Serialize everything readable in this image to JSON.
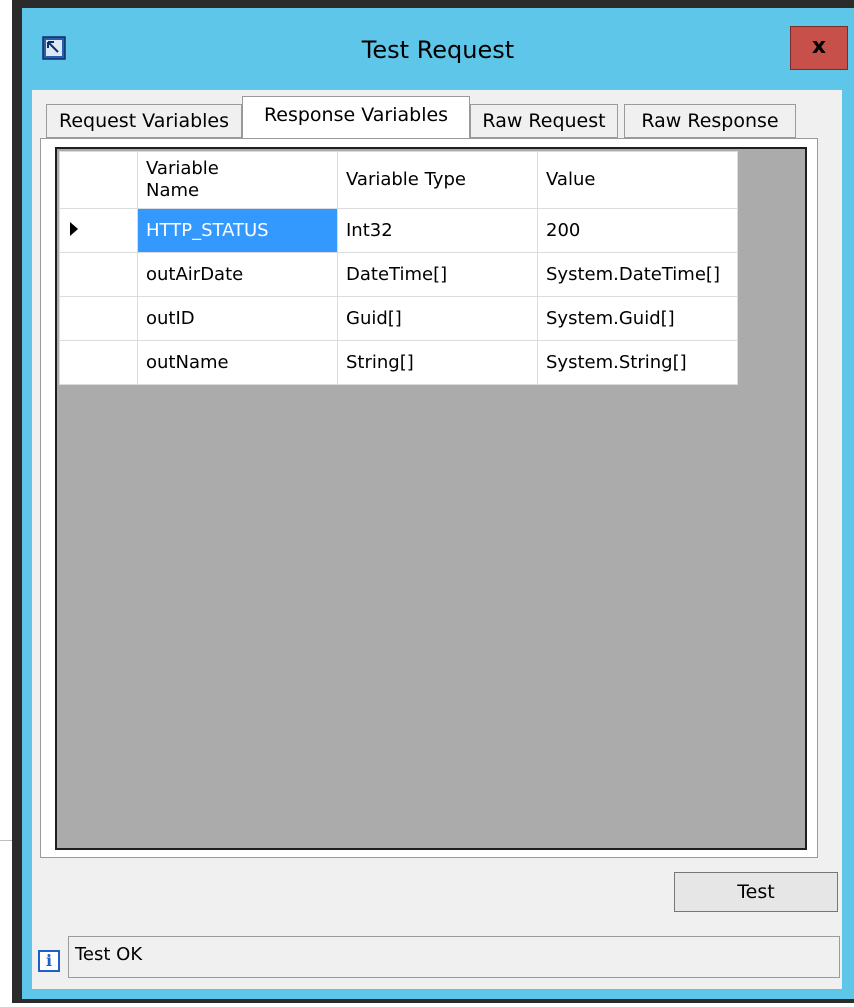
{
  "window": {
    "title": "Test Request",
    "close_label": "x"
  },
  "tabs": [
    {
      "label": "Request Variables",
      "active": false
    },
    {
      "label": "Response Variables",
      "active": true
    },
    {
      "label": "Raw Request",
      "active": false
    },
    {
      "label": "Raw Response",
      "active": false
    }
  ],
  "grid": {
    "columns": [
      "Variable Name",
      "Variable Type",
      "Value"
    ],
    "rows": [
      {
        "name": "HTTP_STATUS",
        "type": "Int32",
        "value": "200",
        "selected": true
      },
      {
        "name": "outAirDate",
        "type": "DateTime[]",
        "value": "System.DateTime[]",
        "selected": false
      },
      {
        "name": "outID",
        "type": "Guid[]",
        "value": "System.Guid[]",
        "selected": false
      },
      {
        "name": "outName",
        "type": "String[]",
        "value": "System.String[]",
        "selected": false
      }
    ]
  },
  "buttons": {
    "test_label": "Test"
  },
  "status": {
    "icon": "info-icon",
    "text": "Test OK"
  },
  "colors": {
    "frame": "#5ec6e8",
    "close": "#c7504a",
    "selection": "#3399ff",
    "grid_background": "#ababab"
  }
}
